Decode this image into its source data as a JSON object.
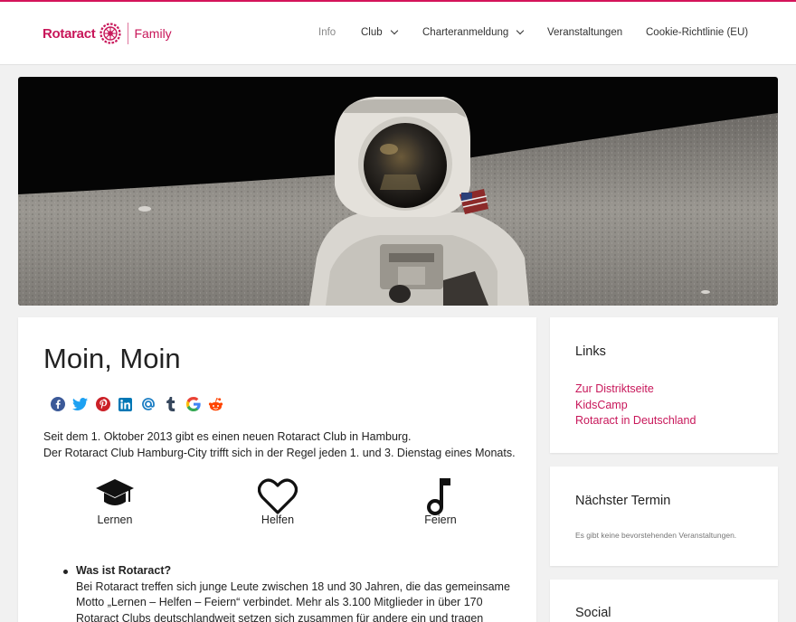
{
  "brand": {
    "name": "Rotaract",
    "suffix": "Family",
    "color": "#c8175a"
  },
  "nav": {
    "items": [
      {
        "label": "Info",
        "active": true,
        "dropdown": false
      },
      {
        "label": "Club",
        "active": false,
        "dropdown": true
      },
      {
        "label": "Charteranmeldung",
        "active": false,
        "dropdown": true
      },
      {
        "label": "Veranstaltungen",
        "active": false,
        "dropdown": false
      },
      {
        "label": "Cookie-Richtlinie (EU)",
        "active": false,
        "dropdown": false
      }
    ]
  },
  "hero": {
    "alt": "astronaut on the moon",
    "image_icon": "astronaut-photo"
  },
  "article": {
    "title": "Moin, Moin",
    "share_icons": [
      "facebook-icon",
      "twitter-icon",
      "pinterest-icon",
      "linkedin-icon",
      "email-icon",
      "tumblr-icon",
      "google-icon",
      "reddit-icon"
    ],
    "intro_line1": "Seit dem 1. Oktober 2013 gibt es einen neuen Rotaract Club in Hamburg.",
    "intro_line2": "Der Rotaract Club Hamburg-City trifft sich in der Regel jeden 1. und 3. Dienstag eines Monats.",
    "features": [
      {
        "label": "Lernen",
        "icon": "graduation-cap-icon"
      },
      {
        "label": "Helfen",
        "icon": "heart-icon"
      },
      {
        "label": "Feiern",
        "icon": "music-note-icon"
      }
    ],
    "faq": {
      "question": "Was ist Rotaract?",
      "answer_line1": "Bei Rotaract treffen sich junge Leute zwischen 18 und 30 Jahren, die das gemeinsame",
      "answer_line2": "Motto „Lernen – Helfen – Feiern“ verbindet. Mehr als 3.100 Mitglieder in über 170",
      "answer_line3": "Rotaract Clubs deutschlandweit setzen sich zusammen für andere ein und tragen"
    }
  },
  "sidebar": {
    "links_title": "Links",
    "links": [
      "Zur Distriktseite",
      "KidsCamp",
      "Rotaract in Deutschland"
    ],
    "event_title": "Nächster Termin",
    "event_text": "Es gibt keine bevorstehenden Veranstaltungen.",
    "social_title": "Social"
  },
  "colors": {
    "accent": "#c8175a",
    "background": "#f1f1f1",
    "panel": "#ffffff"
  }
}
